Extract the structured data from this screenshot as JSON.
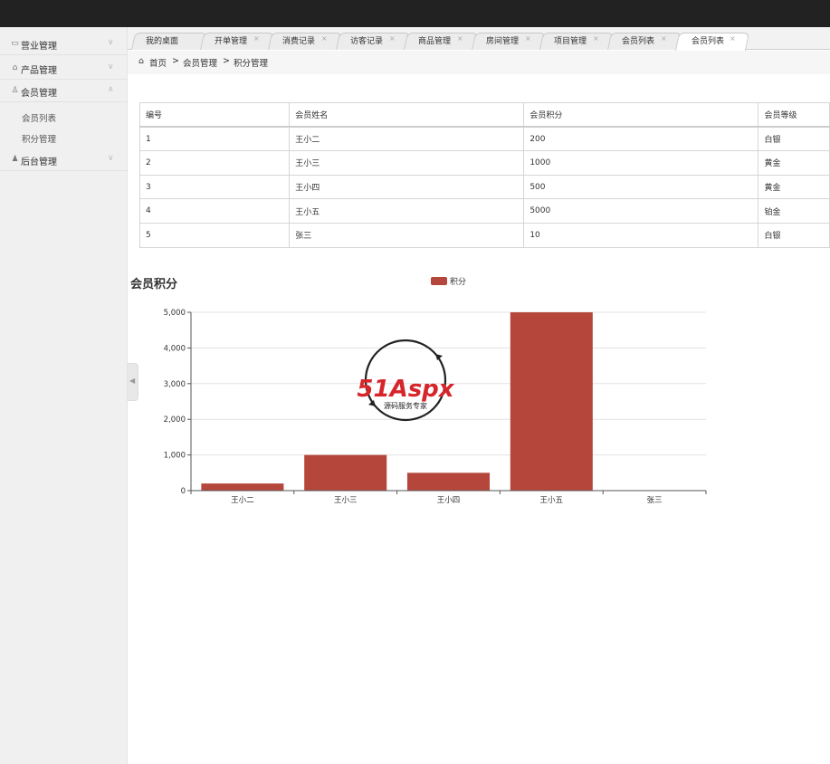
{
  "sidebar": {
    "menus": [
      {
        "label": "营业管理",
        "icon": "computer-icon",
        "chevron": "∨"
      },
      {
        "label": "产品管理",
        "icon": "bag-icon",
        "chevron": "∨"
      },
      {
        "label": "会员管理",
        "icon": "user-outline-icon",
        "chevron": "∧"
      },
      {
        "label": "后台管理",
        "icon": "user-icon",
        "chevron": "∨"
      }
    ],
    "subitems": [
      {
        "label": "会员列表"
      },
      {
        "label": "积分管理"
      }
    ]
  },
  "tabs": [
    {
      "label": "我的桌面",
      "active": false,
      "closable": false
    },
    {
      "label": "开单管理",
      "active": false,
      "closable": true
    },
    {
      "label": "消费记录",
      "active": false,
      "closable": true
    },
    {
      "label": "访客记录",
      "active": false,
      "closable": true
    },
    {
      "label": "商品管理",
      "active": false,
      "closable": true
    },
    {
      "label": "房间管理",
      "active": false,
      "closable": true
    },
    {
      "label": "项目管理",
      "active": false,
      "closable": true
    },
    {
      "label": "会员列表",
      "active": false,
      "closable": true
    },
    {
      "label": "会员列表",
      "active": true,
      "closable": true
    }
  ],
  "tab_close_glyph": "×",
  "breadcrumb": {
    "home": "首页",
    "sep": ">",
    "items": [
      "会员管理",
      "积分管理"
    ]
  },
  "table": {
    "headers": [
      "编号",
      "会员姓名",
      "会员积分",
      "会员等级"
    ],
    "rows": [
      [
        "1",
        "王小二",
        "200",
        "白银"
      ],
      [
        "2",
        "王小三",
        "1000",
        "黄金"
      ],
      [
        "3",
        "王小四",
        "500",
        "黄金"
      ],
      [
        "4",
        "王小五",
        "5000",
        "铂金"
      ],
      [
        "5",
        "张三",
        "10",
        "白银"
      ]
    ]
  },
  "watermark": {
    "brand": "51Aspx",
    "tagline": "源码服务专家"
  },
  "colors": {
    "bar": "#b5463b",
    "accent_green": "#3aa635",
    "accent_red": "#d6262b"
  },
  "chart_data": {
    "type": "bar",
    "title": "会员积分",
    "legend": [
      "积分"
    ],
    "legend_position": "top-center",
    "categories": [
      "王小二",
      "王小三",
      "王小四",
      "王小五",
      "张三"
    ],
    "series": [
      {
        "name": "积分",
        "values": [
          200,
          1000,
          500,
          5000,
          10
        ]
      }
    ],
    "ylim": [
      0,
      5000
    ],
    "yticks": [
      "0",
      "1,000",
      "2,000",
      "3,000",
      "4,000",
      "5,000"
    ],
    "grid": true
  }
}
